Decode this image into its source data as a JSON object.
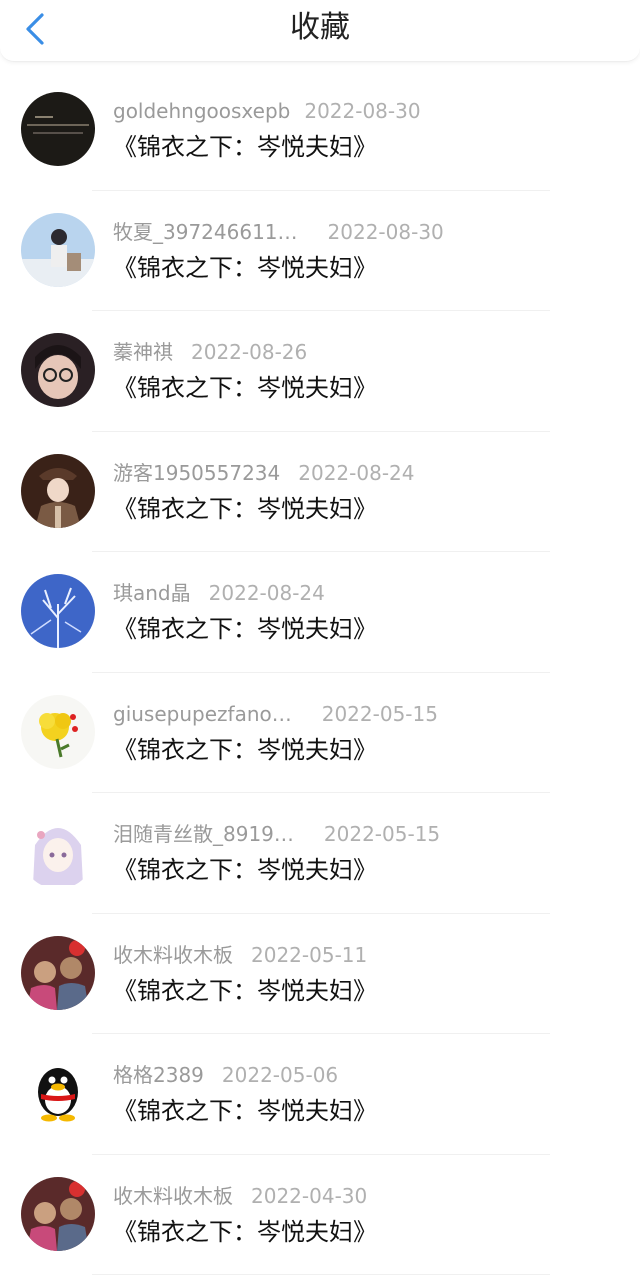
{
  "header": {
    "title": "收藏",
    "back_icon": "chevron-left-icon",
    "accent_color": "#3a8ee6"
  },
  "favorites": [
    {
      "user": "goldehngoosxepb",
      "date": "2022-08-30",
      "work": "《锦衣之下：岑悦夫妇》",
      "avatar_icon": "dark-text-avatar"
    },
    {
      "user": "牧夏_397246611…",
      "date": "2022-08-30",
      "work": "《锦衣之下：岑悦夫妇》",
      "avatar_icon": "sky-figure-avatar"
    },
    {
      "user": "蓁神祺",
      "date": "2022-08-26",
      "work": "《锦衣之下：岑悦夫妇》",
      "avatar_icon": "glasses-face-avatar"
    },
    {
      "user": "游客1950557234",
      "date": "2022-08-24",
      "work": "《锦衣之下：岑悦夫妇》",
      "avatar_icon": "illustrated-officer-avatar"
    },
    {
      "user": "琪and晶",
      "date": "2022-08-24",
      "work": "《锦衣之下：岑悦夫妇》",
      "avatar_icon": "blue-winter-tree-avatar"
    },
    {
      "user": "giusepupezfano…",
      "date": "2022-05-15",
      "work": "《锦衣之下：岑悦夫妇》",
      "avatar_icon": "yellow-flower-avatar"
    },
    {
      "user": "泪随青丝散_8919…",
      "date": "2022-05-15",
      "work": "《锦衣之下：岑悦夫妇》",
      "avatar_icon": "anime-girl-avatar"
    },
    {
      "user": "收木料收木板",
      "date": "2022-05-11",
      "work": "《锦衣之下：岑悦夫妇》",
      "avatar_icon": "two-people-photo-avatar"
    },
    {
      "user": "格格2389",
      "date": "2022-05-06",
      "work": "《锦衣之下：岑悦夫妇》",
      "avatar_icon": "penguin-avatar"
    },
    {
      "user": "收木料收木板",
      "date": "2022-04-30",
      "work": "《锦衣之下：岑悦夫妇》",
      "avatar_icon": "two-people-photo-avatar"
    }
  ]
}
